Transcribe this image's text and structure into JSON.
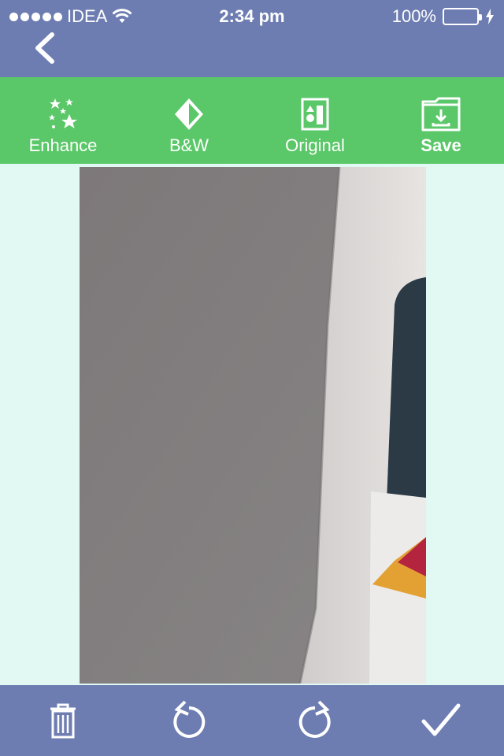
{
  "status_bar": {
    "carrier": "IDEA",
    "time": "2:34 pm",
    "battery": "100%",
    "battery_level": 1.0
  },
  "nav": {
    "back_icon": "chevron-left-icon"
  },
  "filters": [
    {
      "label": "Enhance",
      "icon": "sparkles-icon"
    },
    {
      "label": "B&W",
      "icon": "contrast-diamond-icon"
    },
    {
      "label": "Original",
      "icon": "shapes-icon"
    },
    {
      "label": "Save",
      "icon": "folder-download-icon"
    }
  ],
  "bottom_bar": {
    "buttons": [
      {
        "icon": "trash-icon"
      },
      {
        "icon": "rotate-left-icon"
      },
      {
        "icon": "rotate-right-icon"
      },
      {
        "icon": "checkmark-icon"
      }
    ]
  },
  "colors": {
    "nav_bar": "#6d7db1",
    "filter_bar": "#5ac768",
    "background": "#e2f8f2",
    "battery_fill": "#4cd964"
  }
}
